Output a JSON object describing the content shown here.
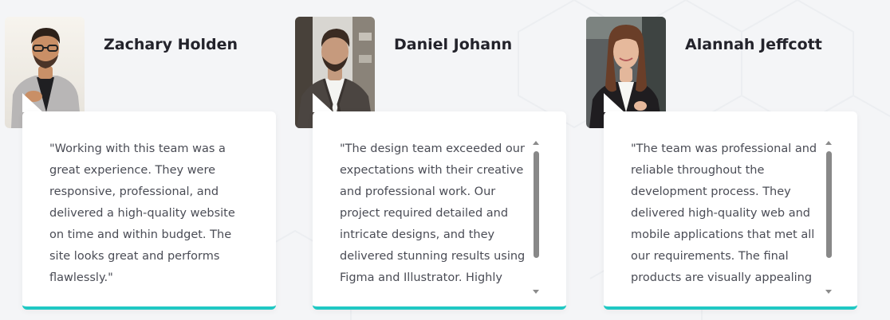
{
  "theme": {
    "background": "#f4f5f7",
    "card_background": "#ffffff",
    "accent": "#1fc8c3",
    "name_color": "#23232b",
    "text_color": "#4a4c55"
  },
  "testimonials": [
    {
      "name": "Zachary Holden",
      "quote": "\"Working with this team was a great experience. They were responsive, professional, and delivered a high-quality website on time and within budget. The site looks great and performs flawlessly.\"",
      "avatar_icon": "person-photo"
    },
    {
      "name": "Daniel Johann",
      "quote": "\"The design team exceeded our expectations with their creative and professional work. Our project required detailed and intricate designs, and they delivered stunning results using Figma and Illustrator. Highly",
      "avatar_icon": "person-photo"
    },
    {
      "name": "Alannah Jeffcott",
      "quote": "\"The team was professional and reliable throughout the development process. They delivered high-quality web and mobile applications that met all our requirements. The final products are visually appealing and functional",
      "avatar_icon": "person-photo"
    }
  ]
}
